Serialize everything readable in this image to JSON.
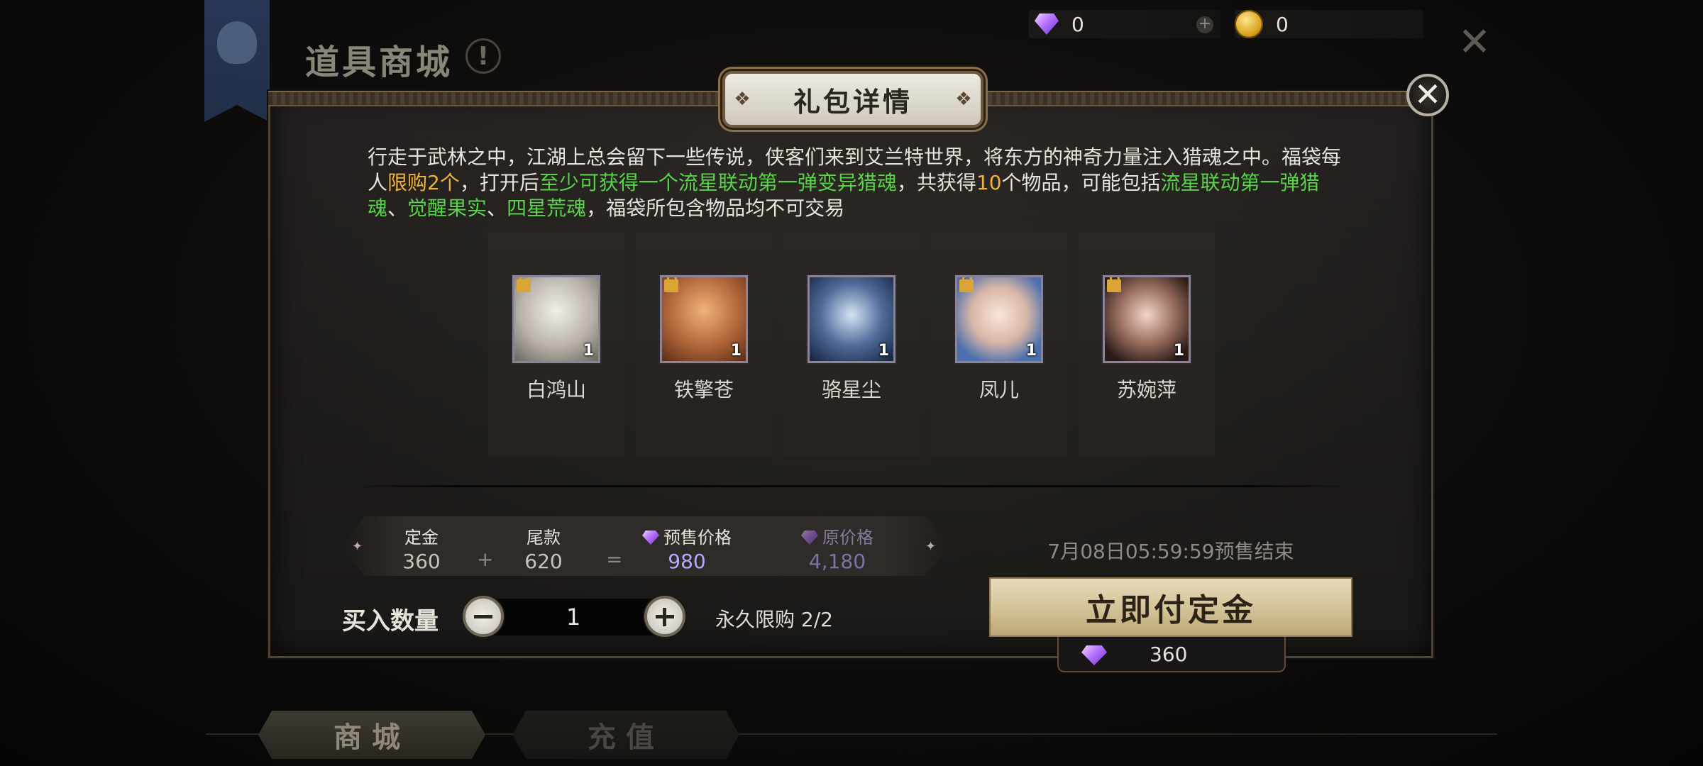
{
  "header": {
    "shop_title": "道具商城",
    "help_glyph": "!",
    "gems": "0",
    "gold": "0",
    "close_glyph": "✕"
  },
  "dialog": {
    "title": "礼包详情",
    "close_glyph": "✕",
    "description": {
      "p1": "行走于武林之中，江湖上总会留下一些传说，侠客们来到艾兰特世界，将东方的神奇力量注入猎魂之中。福袋每人",
      "limit": "限购2个",
      "p2": "，打开后",
      "guarantee": "至少可获得一个流星联动第一弹变异猎魂",
      "p3": "，共获得",
      "count": "10",
      "p4": "个物品，可能包括",
      "item1": "流星联动第一弹猎魂",
      "sep1": "、",
      "item2": "觉醒果实",
      "sep2": "、",
      "item3": "四星荒魂",
      "p5": "，福袋所包含物品均不可交易"
    },
    "rewards": [
      {
        "name": "白鸿山",
        "qty": "1"
      },
      {
        "name": "铁擎苍",
        "qty": "1"
      },
      {
        "name": "骆星尘",
        "qty": "1"
      },
      {
        "name": "凤儿",
        "qty": "1"
      },
      {
        "name": "苏婉萍",
        "qty": "1"
      }
    ],
    "price": {
      "deposit_label": "定金",
      "deposit_value": "360",
      "plus": "+",
      "balance_label": "尾款",
      "balance_value": "620",
      "equals": "=",
      "presale_label": "预售价格",
      "presale_value": "980",
      "original_label": "原价格",
      "original_value": "4,180"
    },
    "end_time": "7月08日05:59:59预售结束",
    "quantity_label": "买入数量",
    "quantity_value": "1",
    "limit_text": "永久限购 2/2",
    "pay_button": "立即付定金",
    "pay_price": "360"
  },
  "tabs": [
    {
      "label": "商城",
      "active": true
    },
    {
      "label": "充值",
      "active": false
    }
  ],
  "colors": {
    "highlight_yellow": "#f0b33a",
    "highlight_green": "#59d34a",
    "presale_price": "#b9a8ff",
    "original_price": "#7d72a8"
  }
}
